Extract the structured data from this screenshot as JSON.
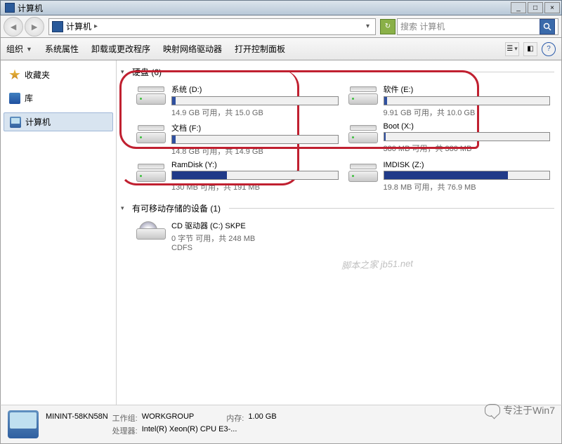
{
  "window": {
    "title": "计算机"
  },
  "winctrl": {
    "min": "_",
    "max": "□",
    "close": "×"
  },
  "nav": {
    "path_icon": "computer-icon",
    "path_text": "计算机",
    "dropdown": "▸",
    "search_placeholder": "搜索 计算机"
  },
  "toolbar": {
    "items": [
      "组织",
      "系统属性",
      "卸载或更改程序",
      "映射网络驱动器",
      "打开控制面板"
    ],
    "has_arrow": [
      true,
      false,
      false,
      false,
      false
    ]
  },
  "sidebar": {
    "items": [
      {
        "label": "收藏夹",
        "icon": "star",
        "sel": false
      },
      {
        "label": "库",
        "icon": "lib",
        "sel": false
      },
      {
        "label": "计算机",
        "icon": "comp",
        "sel": true
      }
    ]
  },
  "sections": {
    "hdd": {
      "title": "硬盘 (6)"
    },
    "removable": {
      "title": "有可移动存储的设备 (1)"
    }
  },
  "drives": [
    {
      "name": "系统 (D:)",
      "free": "14.9 GB 可用，共 15.0 GB",
      "fill_pct": 2,
      "fill_color": "#3050a0"
    },
    {
      "name": "软件 (E:)",
      "free": "9.91 GB 可用，共 10.0 GB",
      "fill_pct": 2,
      "fill_color": "#3050a0"
    },
    {
      "name": "文档 (F:)",
      "free": "14.8 GB 可用，共 14.9 GB",
      "fill_pct": 2,
      "fill_color": "#3050a0"
    },
    {
      "name": "Boot (X:)",
      "free": "380 MB 可用，共 380 MB",
      "fill_pct": 1,
      "fill_color": "#3050a0"
    },
    {
      "name": "RamDisk (Y:)",
      "free": "130 MB 可用，共 191 MB",
      "fill_pct": 33,
      "fill_color": "#203a88"
    },
    {
      "name": "IMDISK (Z:)",
      "free": "19.8 MB 可用，共 76.9 MB",
      "fill_pct": 75,
      "fill_color": "#203a88"
    }
  ],
  "cd": {
    "name": "CD 驱动器 (C:) SKPE",
    "free": "0 字节 可用，共 248 MB",
    "fs": "CDFS"
  },
  "status": {
    "hostname": "MININT-58KN58N",
    "workgroup_label": "工作组:",
    "workgroup": "WORKGROUP",
    "mem_label": "内存:",
    "mem": "1.00 GB",
    "cpu_label": "处理器:",
    "cpu": "Intel(R) Xeon(R) CPU E3-..."
  },
  "watermark": {
    "corner": "专注于Win7",
    "center": "脚本之家 jb51.net"
  }
}
